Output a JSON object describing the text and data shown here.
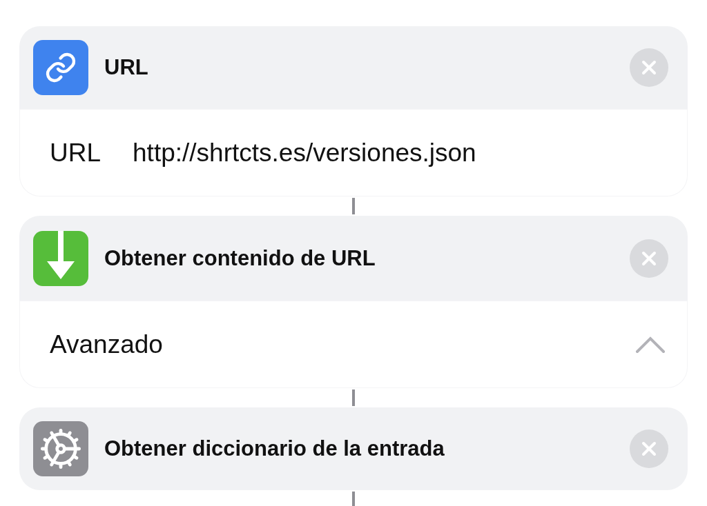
{
  "actions": [
    {
      "title": "URL",
      "kind": "link",
      "color": "#3f83ee",
      "fields": [
        {
          "kind": "parameter",
          "label": "URL",
          "value": "http://shrtcts.es/versiones.json"
        }
      ]
    },
    {
      "title": "Obtener contenido de URL",
      "kind": "download",
      "color": "#56bd3a",
      "fields": [
        {
          "kind": "expander",
          "label": "Avanzado",
          "expanded": true
        }
      ]
    },
    {
      "title": "Obtener diccionario de la entrada",
      "kind": "gear",
      "color": "#8e8e93"
    }
  ]
}
